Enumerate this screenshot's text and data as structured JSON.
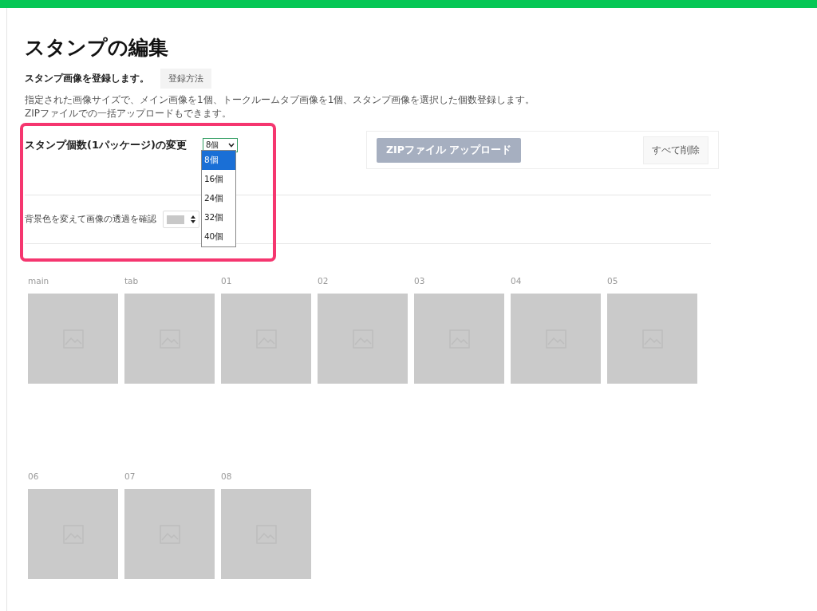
{
  "title": "スタンプの編集",
  "subtitle": "スタンプ画像を登録します。",
  "help_button": "登録方法",
  "description": [
    "指定された画像サイズで、メイン画像を1個、トークルームタブ画像を1個、スタンプ画像を選択した個数登録します。",
    "ZIPファイルでの一括アップロードもできます。"
  ],
  "count_select": {
    "label": "スタンプ個数(1パッケージ)の変更",
    "value": "8個",
    "expanded": true,
    "options": [
      {
        "label": "8個",
        "selected": true
      },
      {
        "label": "16個",
        "selected": false
      },
      {
        "label": "24個",
        "selected": false
      },
      {
        "label": "32個",
        "selected": false
      },
      {
        "label": "40個",
        "selected": false
      }
    ]
  },
  "upload_button": {
    "label": "ZIPファイル アップロード",
    "disabled": true
  },
  "delete_all_button": "すべて削除",
  "background_check": {
    "label": "背景色を変えて画像の透過を確認"
  },
  "stamps": [
    {
      "label": "main"
    },
    {
      "label": "tab"
    },
    {
      "label": "01"
    },
    {
      "label": "02"
    },
    {
      "label": "03"
    },
    {
      "label": "04"
    },
    {
      "label": "05"
    },
    {
      "label": "06"
    },
    {
      "label": "07"
    },
    {
      "label": "08"
    }
  ]
}
